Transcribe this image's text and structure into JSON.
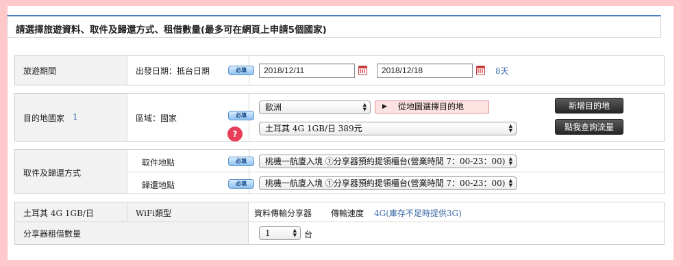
{
  "header": {
    "title": "請選擇旅遊資料、取件及歸還方式、租借數量(最多可在網頁上申請5個國家)"
  },
  "required_label": "必填",
  "travel": {
    "label": "旅遊期間",
    "sublabel": "出發日期：抵台日期",
    "start_date": "2018/12/11",
    "end_date": "2018/12/18",
    "days": "8天"
  },
  "destination": {
    "label": "目的地國家",
    "index": "1",
    "sublabel": "區域：國家",
    "region_value": "歐洲",
    "map_button": "從地圖選擇目的地",
    "country_plan_value": "土耳其 4G 1GB/日 389元",
    "add_destination_button": "新增目的地",
    "check_data_button": "點我查詢流量",
    "help_symbol": "?"
  },
  "pickup": {
    "label": "取件及歸還方式",
    "pickup_label": "取件地點",
    "pickup_value": "桃機一航廈入境 ①分享器預約提領櫃台(營業時間 7：00-23：00)",
    "return_label": "歸還地點",
    "return_value": "桃機一航廈入境 ①分享器預約提領櫃台(營業時間 7：00-23：00)"
  },
  "device": {
    "plan_label": "土耳其 4G 1GB/日",
    "wifi_type_label": "WiFi類型",
    "wifi_type_value": "資料傳輸分享器",
    "speed_label": "傳輸速度",
    "speed_value": "4G(庫存不足時提供3G)",
    "quantity_label": "分享器租借數量",
    "quantity_value": "1",
    "quantity_unit": "台"
  }
}
